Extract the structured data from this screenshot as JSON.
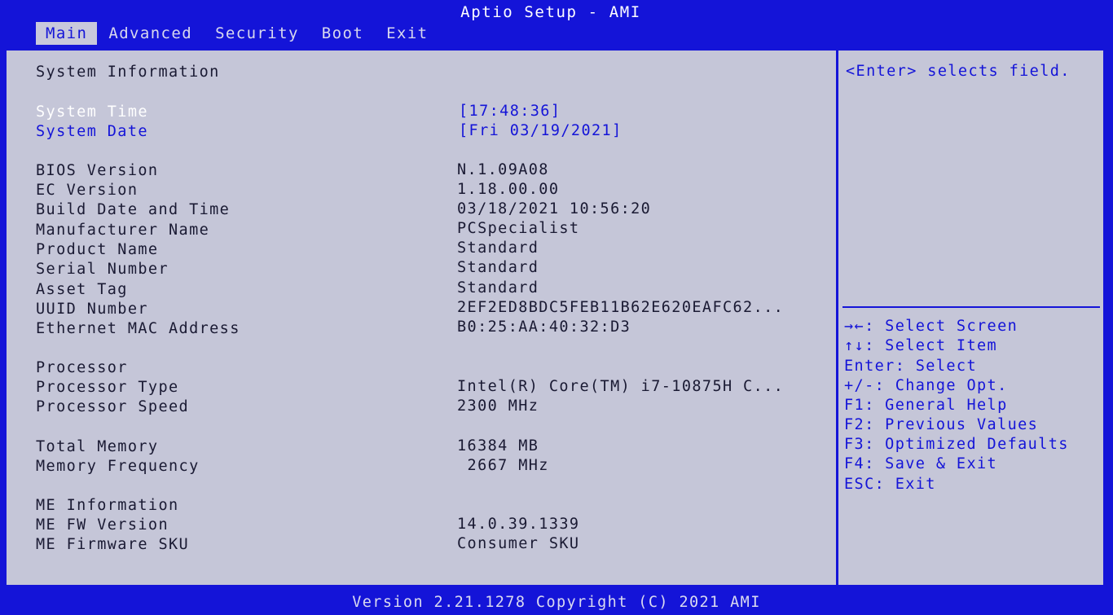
{
  "header": {
    "title": "Aptio Setup - AMI",
    "tabs": [
      {
        "label": "Main"
      },
      {
        "label": "Advanced"
      },
      {
        "label": "Security"
      },
      {
        "label": "Boot"
      },
      {
        "label": "Exit"
      }
    ]
  },
  "main": {
    "section_system": "System Information",
    "system_time": {
      "label": "System Time",
      "value": "[17:48:36]"
    },
    "system_date": {
      "label": "System Date",
      "value": "[Fri 03/19/2021]"
    },
    "bios_version": {
      "label": "BIOS Version",
      "value": "N.1.09A08"
    },
    "ec_version": {
      "label": "EC Version",
      "value": "1.18.00.00"
    },
    "build_date": {
      "label": "Build Date and Time",
      "value": "03/18/2021 10:56:20"
    },
    "manufacturer": {
      "label": "Manufacturer Name",
      "value": "PCSpecialist"
    },
    "product_name": {
      "label": "Product Name",
      "value": "Standard"
    },
    "serial_number": {
      "label": "Serial Number",
      "value": "Standard"
    },
    "asset_tag": {
      "label": "Asset Tag",
      "value": "Standard"
    },
    "uuid": {
      "label": "UUID Number",
      "value": "2EF2ED8BDC5FEB11B62E620EAFC62..."
    },
    "mac": {
      "label": "Ethernet MAC Address",
      "value": "B0:25:AA:40:32:D3"
    },
    "section_processor": "Processor",
    "processor_type": {
      "label": "Processor Type",
      "value": "Intel(R) Core(TM) i7-10875H C..."
    },
    "processor_speed": {
      "label": "Processor Speed",
      "value": "2300 MHz"
    },
    "total_memory": {
      "label": "Total Memory",
      "value": "16384 MB"
    },
    "memory_frequency": {
      "label": "Memory Frequency",
      "value": " 2667 MHz"
    },
    "section_me": "ME Information",
    "me_fw_version": {
      "label": "ME FW Version",
      "value": "14.0.39.1339"
    },
    "me_fw_sku": {
      "label": "ME Firmware SKU",
      "value": "Consumer SKU"
    }
  },
  "help": {
    "description": "<Enter> selects field.",
    "keys": [
      "→←: Select Screen",
      "↑↓: Select Item",
      "Enter: Select",
      "+/-: Change Opt.",
      "F1: General Help",
      "F2: Previous Values",
      "F3: Optimized Defaults",
      "F4: Save & Exit",
      "ESC: Exit"
    ]
  },
  "footer": {
    "version": "Version 2.21.1278 Copyright (C) 2021 AMI"
  },
  "colors": {
    "bios_blue": "#1414d8",
    "panel_gray": "#c5c6d8",
    "text_dark": "#1a1a33",
    "highlight": "#ffffff"
  }
}
